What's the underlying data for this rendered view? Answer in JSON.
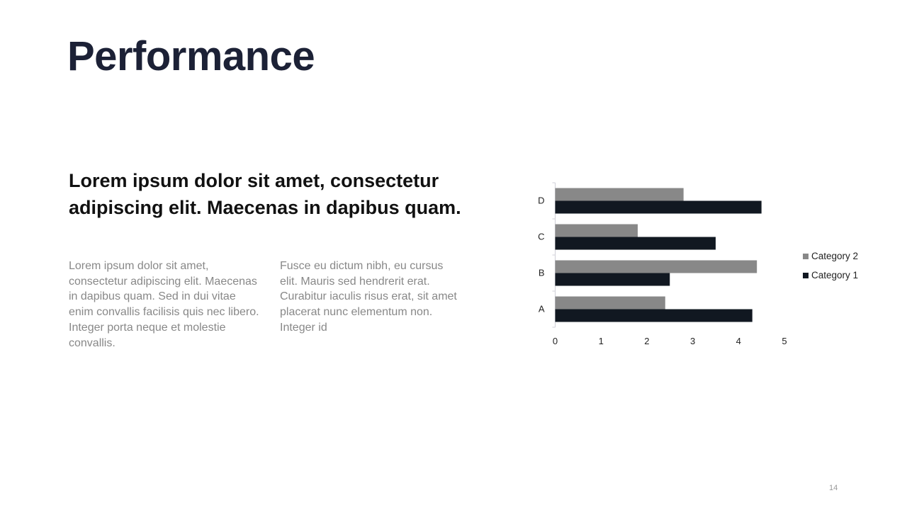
{
  "slide": {
    "title": "Performance",
    "subtitle": "Lorem ipsum dolor sit amet, consectetur adipiscing elit. Maecenas in dapibus quam.",
    "body_left": "Lorem ipsum dolor sit amet, consectetur adipiscing elit. Maecenas in dapibus quam. Sed in dui vitae enim convallis facilisis quis nec libero. Integer porta neque et molestie convallis.",
    "body_right": "Fusce eu dictum nibh, eu cursus elit. Mauris sed hendrerit erat. Curabitur iaculis risus erat, sit amet placerat nunc elementum non. Integer id",
    "page_number": "14"
  },
  "chart_data": {
    "type": "bar",
    "orientation": "horizontal",
    "title": "",
    "xlabel": "",
    "ylabel": "",
    "categories": [
      "A",
      "B",
      "C",
      "D"
    ],
    "series": [
      {
        "name": "Category 1",
        "color": "#111821",
        "values": [
          4.3,
          2.5,
          3.5,
          4.5
        ]
      },
      {
        "name": "Category 2",
        "color": "#888888",
        "values": [
          2.4,
          4.4,
          1.8,
          2.8
        ]
      }
    ],
    "xlim": [
      0,
      5
    ],
    "xticks": [
      "0",
      "1",
      "2",
      "3",
      "4",
      "5"
    ],
    "grid": false,
    "legend": {
      "position": "right",
      "entries": [
        "Category 2",
        "Category 1"
      ]
    }
  }
}
